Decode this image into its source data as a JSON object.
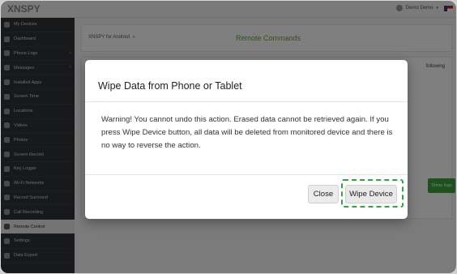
{
  "app": {
    "logo_text": "XNSPY",
    "user_name": "Demo Demo",
    "caret": "▾"
  },
  "sidebar": {
    "items": [
      {
        "label": "My Devices",
        "icon": "phone-icon",
        "arrow": ""
      },
      {
        "label": "Dashboard",
        "icon": "dashboard-icon",
        "arrow": ""
      },
      {
        "label": "Phone Logs",
        "icon": "phone-logs-icon",
        "arrow": "›"
      },
      {
        "label": "Messages",
        "icon": "messages-icon",
        "arrow": "›"
      },
      {
        "label": "Installed Apps",
        "icon": "apps-icon",
        "arrow": ""
      },
      {
        "label": "Screen Time",
        "icon": "clock-icon",
        "arrow": ""
      },
      {
        "label": "Locations",
        "icon": "location-pin-icon",
        "arrow": ""
      },
      {
        "label": "Videos",
        "icon": "video-icon",
        "arrow": ""
      },
      {
        "label": "Photos",
        "icon": "camera-icon",
        "arrow": ""
      },
      {
        "label": "Screen Record",
        "icon": "screen-record-icon",
        "arrow": ""
      },
      {
        "label": "Key Logger",
        "icon": "keyboard-icon",
        "arrow": ""
      },
      {
        "label": "Wi-Fi Networks",
        "icon": "wifi-icon",
        "arrow": ""
      },
      {
        "label": "Record Surround",
        "icon": "microphone-icon",
        "arrow": ""
      },
      {
        "label": "Call Recording",
        "icon": "call-recording-icon",
        "arrow": ""
      },
      {
        "label": "Remote Control",
        "icon": "remote-control-icon",
        "arrow": "",
        "active": true
      },
      {
        "label": "Settings",
        "icon": "gear-icon",
        "arrow": ""
      },
      {
        "label": "Data Export",
        "icon": "download-icon",
        "arrow": ""
      }
    ]
  },
  "main": {
    "device_select": "XNSPY for Android",
    "device_caret": "▾",
    "title": "Remote Commands",
    "background_text": "following",
    "show_button": "Show logs"
  },
  "modal": {
    "title": "Wipe Data from Phone or Tablet",
    "body": "Warning! You cannot undo this action. Erased data cannot be retrieved again. If you press Wipe Device button, all data will be deleted from monitored device and there is no way to reverse the action.",
    "close_label": "Close",
    "wipe_label": "Wipe Device"
  },
  "colors": {
    "brand_green": "#5aa832",
    "highlight_green": "#2fa83a",
    "sidebar_bg": "#2f3237"
  }
}
